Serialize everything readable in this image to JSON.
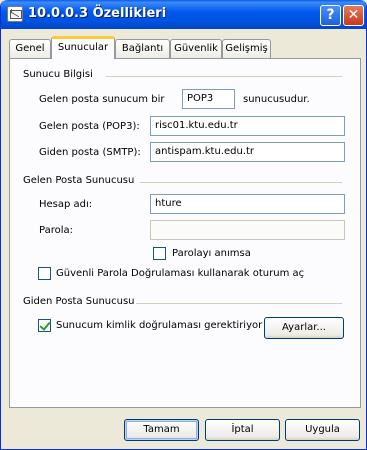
{
  "window": {
    "title": "10.0.0.3 Özellikleri",
    "help_glyph": "?",
    "close_glyph": "✕"
  },
  "tabs": [
    {
      "label": "Genel",
      "active": false
    },
    {
      "label": "Sunucular",
      "active": true
    },
    {
      "label": "Bağlantı",
      "active": false
    },
    {
      "label": "Güvenlik",
      "active": false
    },
    {
      "label": "Gelişmiş",
      "active": false
    }
  ],
  "server_info": {
    "heading": "Sunucu Bilgisi",
    "incoming_prefix": "Gelen posta sunucum bir",
    "incoming_type": "POP3",
    "incoming_suffix": "sunucusudur.",
    "pop3_label": "Gelen posta (POP3):",
    "pop3_value": "risc01.ktu.edu.tr",
    "smtp_label": "Giden posta (SMTP):",
    "smtp_value": "antispam.ktu.edu.tr"
  },
  "incoming_server": {
    "heading": "Gelen Posta Sunucusu",
    "account_label": "Hesap adı:",
    "account_value": "hture",
    "password_label": "Parola:",
    "password_value": "",
    "remember_label": "Parolayı anımsa",
    "remember_checked": false,
    "spa_label": "Güvenli Parola Doğrulaması kullanarak oturum aç",
    "spa_checked": false
  },
  "outgoing_server": {
    "heading": "Giden Posta Sunucusu",
    "auth_label": "Sunucum kimlik doğrulaması gerektiriyor",
    "auth_checked": true,
    "settings_button": "Ayarlar..."
  },
  "buttons": {
    "ok": "Tamam",
    "cancel": "İptal",
    "apply": "Uygula"
  }
}
